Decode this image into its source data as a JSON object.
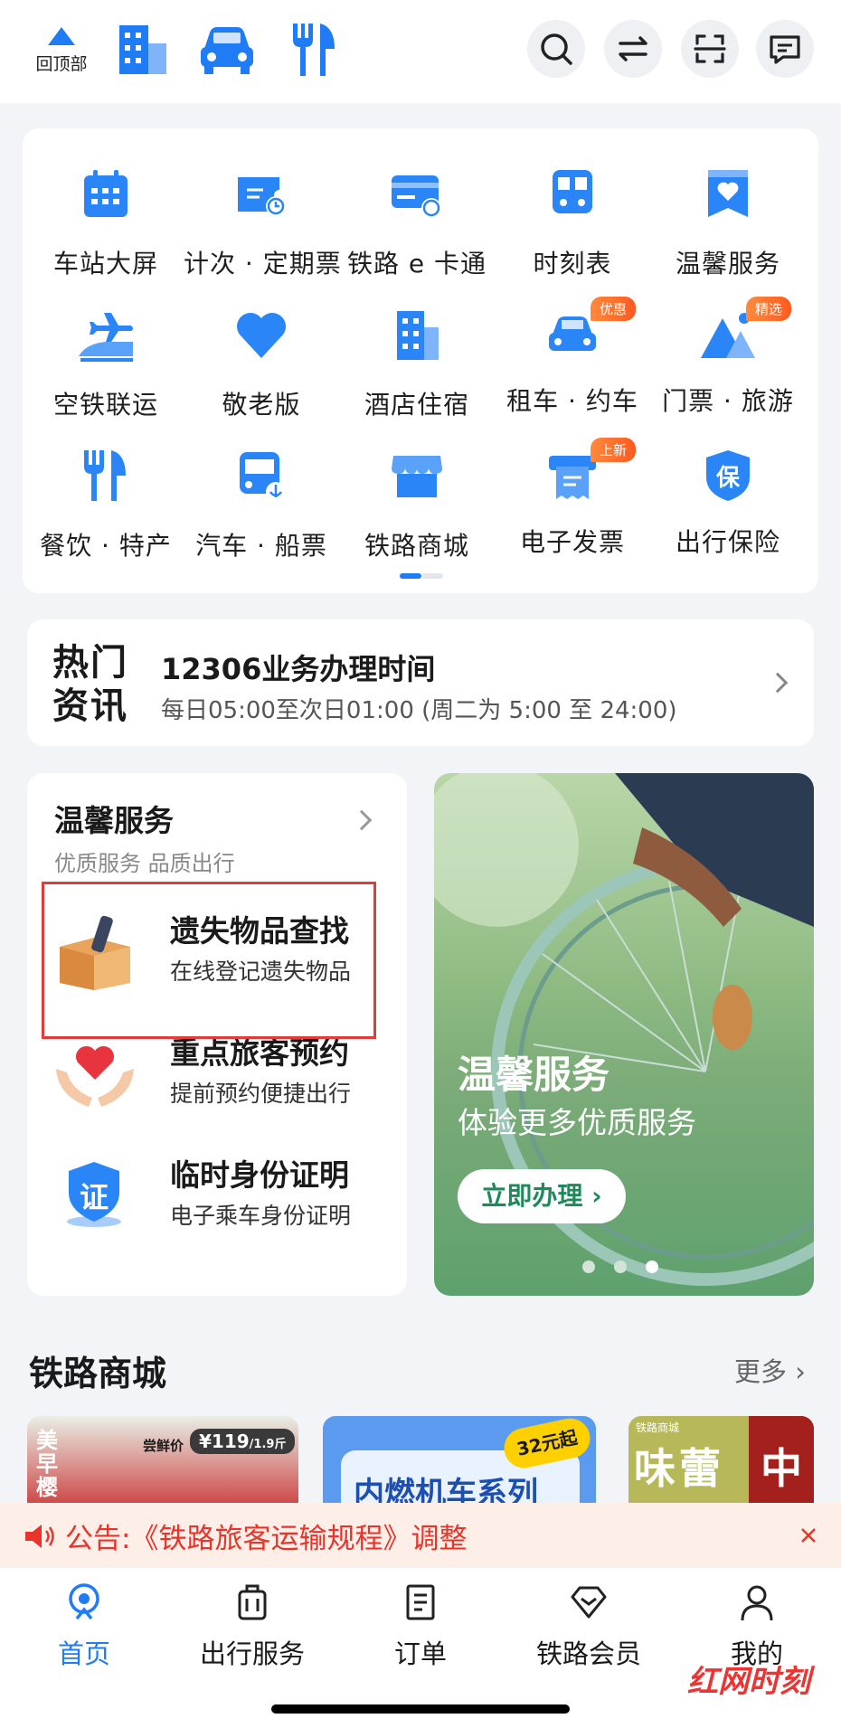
{
  "header": {
    "back_to_top_label": "回顶部",
    "icons": [
      "hotel-icon",
      "car-icon",
      "dining-icon"
    ],
    "right_icons": [
      "search-icon",
      "swap-icon",
      "scan-icon",
      "message-icon"
    ]
  },
  "grid": {
    "items": [
      {
        "label": "车站大屏",
        "icon": "calendar-icon"
      },
      {
        "label": "计次 · 定期票",
        "icon": "ticket-clock-icon"
      },
      {
        "label": "铁路 e 卡通",
        "icon": "railcard-icon"
      },
      {
        "label": "时刻表",
        "icon": "train-icon"
      },
      {
        "label": "温馨服务",
        "icon": "heart-bookmark-icon"
      },
      {
        "label": "空铁联运",
        "icon": "plane-train-icon"
      },
      {
        "label": "敬老版",
        "icon": "heart-icon"
      },
      {
        "label": "酒店住宿",
        "icon": "hotel-icon"
      },
      {
        "label": "租车 · 约车",
        "icon": "car-icon",
        "badge": "优惠"
      },
      {
        "label": "门票 · 旅游",
        "icon": "mountain-icon",
        "badge": "精选"
      },
      {
        "label": "餐饮 · 特产",
        "icon": "dining-icon"
      },
      {
        "label": "汽车 · 船票",
        "icon": "bus-icon"
      },
      {
        "label": "铁路商城",
        "icon": "store-icon"
      },
      {
        "label": "电子发票",
        "icon": "invoice-icon",
        "badge": "上新"
      },
      {
        "label": "出行保险",
        "icon": "insurance-shield-icon",
        "icon_text": "保"
      }
    ]
  },
  "news": {
    "tag": "热门资讯",
    "tag_line1": "热门",
    "tag_line2": "资讯",
    "title": "12306业务办理时间",
    "desc": "每日05:00至次日01:00 (周二为 5:00 至 24:00)"
  },
  "warm_service": {
    "title": "温馨服务",
    "subtitle": "优质服务 品质出行",
    "items": [
      {
        "title": "遗失物品查找",
        "desc": "在线登记遗失物品",
        "icon": "lost-box-icon"
      },
      {
        "title": "重点旅客预约",
        "desc": "提前预约便捷出行",
        "icon": "care-heart-icon"
      },
      {
        "title": "临时身份证明",
        "desc": "电子乘车身份证明",
        "icon": "id-certificate-icon",
        "icon_text": "证"
      }
    ]
  },
  "banner": {
    "title": "温馨服务",
    "desc": "体验更多优质服务",
    "button": "立即办理",
    "dots_total": 3,
    "dots_active": 3
  },
  "mall": {
    "title": "铁路商城",
    "more": "更多",
    "cards": [
      {
        "text_1": "美早樱",
        "text_2": "尝鲜价",
        "price": "¥119",
        "unit": "/1.9斤"
      },
      {
        "text_1": "内燃机车系列",
        "text_2": "32元起"
      },
      {
        "text_1": "铁路商城",
        "text_2": "味蕾",
        "text_3": "中"
      }
    ]
  },
  "notice": {
    "text": "公告:《铁路旅客运输规程》调整"
  },
  "tabs": [
    {
      "label": "首页",
      "icon": "home-icon",
      "active": true
    },
    {
      "label": "出行服务",
      "icon": "luggage-icon"
    },
    {
      "label": "订单",
      "icon": "order-icon"
    },
    {
      "label": "铁路会员",
      "icon": "diamond-icon"
    },
    {
      "label": "我的",
      "icon": "user-icon"
    }
  ],
  "watermark": "红网时刻",
  "colors": {
    "accent": "#1f7cf5",
    "notice": "#e8342a",
    "badge": "#ff6a2b"
  }
}
